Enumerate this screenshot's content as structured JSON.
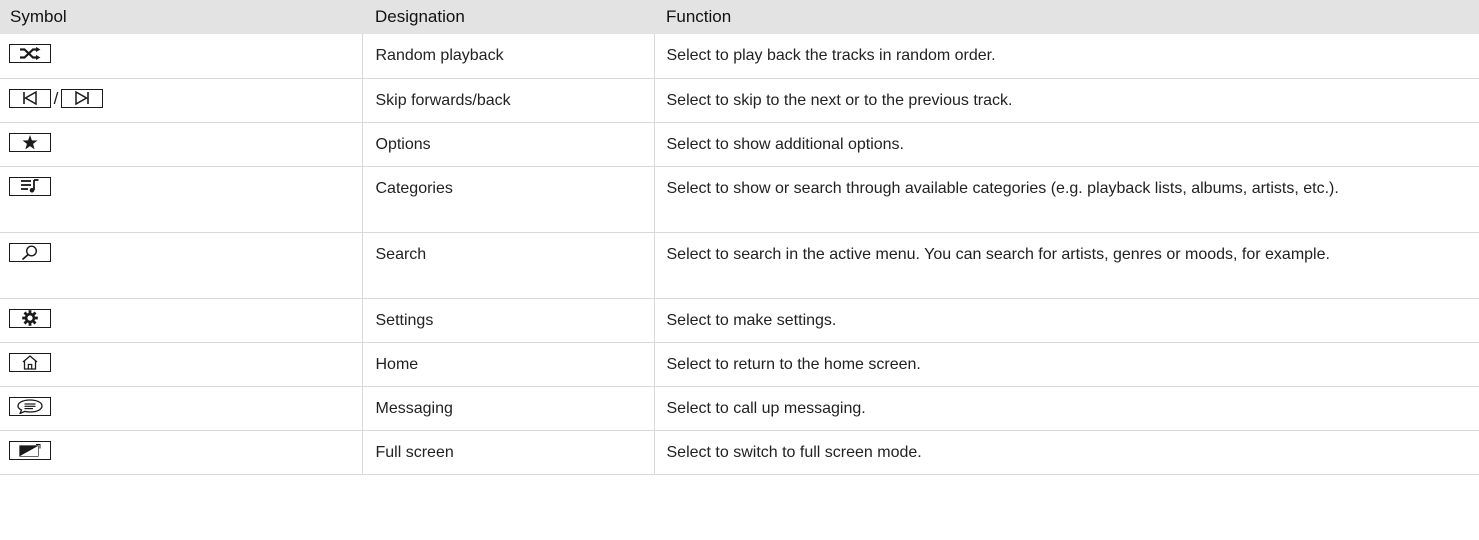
{
  "table": {
    "headers": {
      "symbol": "Symbol",
      "designation": "Designation",
      "function": "Function"
    },
    "rows": [
      {
        "icons": [
          "shuffle-icon"
        ],
        "designation": "Random playback",
        "function": "Select to play back the tracks in random order."
      },
      {
        "icons": [
          "skip-back-icon",
          "skip-forward-icon"
        ],
        "separator": "/",
        "designation": "Skip forwards/back",
        "function": "Select to skip to the next or to the previous track."
      },
      {
        "icons": [
          "star-icon"
        ],
        "designation": "Options",
        "function": "Select to show additional options."
      },
      {
        "icons": [
          "playlist-icon"
        ],
        "designation": "Categories",
        "function": "Select to show or search through available categories (e.g. playback lists, albums, artists, etc.)."
      },
      {
        "icons": [
          "search-icon"
        ],
        "designation": "Search",
        "function": "Select to search in the active menu. You can search for artists, genres or moods, for example."
      },
      {
        "icons": [
          "gear-icon"
        ],
        "designation": "Settings",
        "function": "Select to make settings."
      },
      {
        "icons": [
          "home-icon"
        ],
        "designation": "Home",
        "function": "Select to return to the home screen."
      },
      {
        "icons": [
          "message-icon"
        ],
        "designation": "Messaging",
        "function": "Select to call up messaging."
      },
      {
        "icons": [
          "fullscreen-icon"
        ],
        "designation": "Full screen",
        "function": "Select to switch to full screen mode."
      }
    ]
  }
}
